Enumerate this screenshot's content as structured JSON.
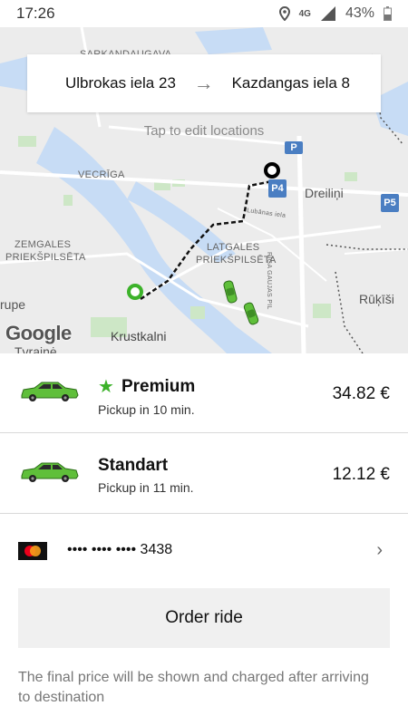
{
  "status_bar": {
    "time": "17:26",
    "network": "4G",
    "battery": "43%",
    "icons": [
      "location-icon",
      "network-4g-icon",
      "signal-icon",
      "battery-icon"
    ]
  },
  "map": {
    "route": {
      "from": "Ulbrokas iela 23",
      "to": "Kazdangas iela 8",
      "arrow_icon": "arrow-right-icon"
    },
    "hint": "Tap to edit locations",
    "labels": {
      "sarkandaugava": "SARKANDAUGAVA",
      "vecriga": "VECRĪGA",
      "dreilini": "Dreiliņi",
      "zemgales_1": "ZEMGALES",
      "zemgales_2": "PRIEKŠPILSĒTA",
      "latgales_1": "LATGALES",
      "latgales_2": "PRIEKŠPILSĒTA",
      "rupe": "rupe",
      "rukisi": "Rūķīši",
      "krustkalni": "Krustkalni",
      "tvraine": "Tvrainė",
      "lubanas": "Lubānas iela",
      "gaujas": "RĪGA GAUJAS PIL"
    },
    "parking": [
      "P",
      "P4",
      "P5"
    ],
    "google": "Google",
    "colors": {
      "route_line": "#111111",
      "pickup": "#3cb22a",
      "destination": "#000000",
      "taxi": "#5fbf3a"
    }
  },
  "rides": [
    {
      "name": "Premium",
      "pickup": "Pickup in 10 min.",
      "price": "34.82 €",
      "starred": true
    },
    {
      "name": "Standart",
      "pickup": "Pickup in 11 min.",
      "price": "12.12 €",
      "starred": false
    }
  ],
  "payment": {
    "card": "•••• •••• •••• 3438",
    "card_icon": "mastercard-icon",
    "chevron_icon": "chevron-right-icon"
  },
  "order_button": "Order ride",
  "footnote": "The final price will be shown and charged after arriving to destination",
  "theme": {
    "accent_green": "#3cb22a",
    "button_bg": "#f0f0f0"
  }
}
